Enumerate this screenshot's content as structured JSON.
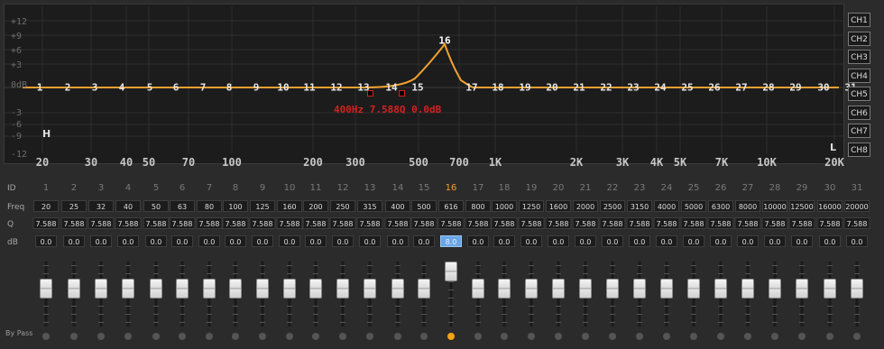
{
  "graph": {
    "y_labels": [
      "+12",
      "+9",
      "+6",
      "+3",
      "0dB",
      "-3",
      "-6",
      "-9",
      "-12"
    ],
    "x_labels": [
      "20",
      "30",
      "40",
      "50",
      "70",
      "100",
      "200",
      "300",
      "500",
      "700",
      "1K",
      "2K",
      "3K",
      "4K",
      "5K",
      "7K",
      "10K",
      "20K"
    ],
    "corner_h": "H",
    "corner_l": "L",
    "tooltip": "400Hz 7.588Q 0.0dB",
    "line_color": "#f0a030"
  },
  "channels": [
    "CH1",
    "CH2",
    "CH3",
    "CH4",
    "CH5",
    "CH6",
    "CH7",
    "CH8"
  ],
  "table": {
    "labels": {
      "id": "ID",
      "freq": "Freq",
      "q": "Q",
      "db": "dB"
    },
    "ids": [
      "1",
      "2",
      "3",
      "4",
      "5",
      "6",
      "7",
      "8",
      "9",
      "10",
      "11",
      "12",
      "13",
      "14",
      "15",
      "16",
      "17",
      "18",
      "19",
      "20",
      "21",
      "22",
      "23",
      "24",
      "25",
      "26",
      "27",
      "28",
      "29",
      "30",
      "31"
    ],
    "freqs": [
      "20",
      "25",
      "32",
      "40",
      "50",
      "63",
      "80",
      "100",
      "125",
      "160",
      "200",
      "250",
      "315",
      "400",
      "500",
      "616",
      "800",
      "1000",
      "1250",
      "1600",
      "2000",
      "2500",
      "3150",
      "4000",
      "5000",
      "6300",
      "8000",
      "10000",
      "12500",
      "16000",
      "20000"
    ],
    "qs": [
      "7.588",
      "7.588",
      "7.588",
      "7.588",
      "7.588",
      "7.588",
      "7.588",
      "7.588",
      "7.588",
      "7.588",
      "7.588",
      "7.588",
      "7.588",
      "7.588",
      "7.588",
      "7.588",
      "7.588",
      "7.588",
      "7.588",
      "7.588",
      "7.588",
      "7.588",
      "7.588",
      "7.588",
      "7.588",
      "7.588",
      "7.588",
      "7.588",
      "7.588",
      "7.588",
      "7.588"
    ],
    "dbs": [
      "0.0",
      "0.0",
      "0.0",
      "0.0",
      "0.0",
      "0.0",
      "0.0",
      "0.0",
      "0.0",
      "0.0",
      "0.0",
      "0.0",
      "0.0",
      "0.0",
      "0.0",
      "8.0",
      "0.0",
      "0.0",
      "0.0",
      "0.0",
      "0.0",
      "0.0",
      "0.0",
      "0.0",
      "0.0",
      "0.0",
      "0.0",
      "0.0",
      "0.0",
      "0.0",
      "0.0"
    ],
    "active_band": "16"
  },
  "bypass_label": "By Pass",
  "colors": {
    "accent": "#f0a030",
    "selected_cell": "#6aa6e6",
    "tooltip": "#d62020"
  }
}
